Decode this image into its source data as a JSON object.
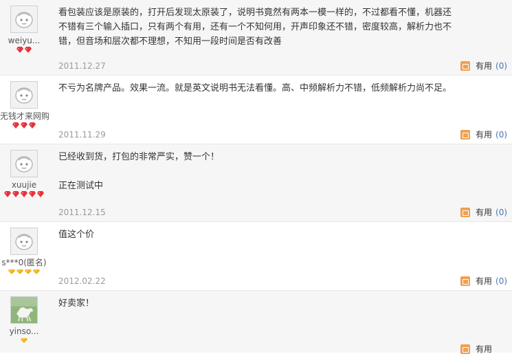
{
  "reviews": [
    {
      "username": "weiyu...",
      "level_icon": "red-diamond",
      "level_count": 2,
      "avatar": "default-face",
      "content": [
        "看包装应该是原装的，打开后发现太原装了，说明书竟然有两本一模一样的，不过都看不懂，机器还不错有三个输入插口，只有两个有用，还有一个不知何用，开声印象还不错，密度较高，解析力也不错，但音场和层次都不理想，不知用一段时间是否有改善"
      ],
      "date": "2011.12.27",
      "useful_label": "有用",
      "useful_count": "(0)"
    },
    {
      "username": "无钱才来网购",
      "level_icon": "red-diamond",
      "level_count": 3,
      "avatar": "default-face",
      "content": [
        "不亏为名牌产品。效果一流。就是英文说明书无法看懂。高、中频解析力不错，低频解析力尚不足。"
      ],
      "date": "2011.11.29",
      "useful_label": "有用",
      "useful_count": "(0)"
    },
    {
      "username": "xuujie",
      "level_icon": "red-diamond",
      "level_count": 5,
      "avatar": "default-face",
      "content": [
        "已经收到货，打包的非常严实，赞一个！",
        "正在测试中"
      ],
      "date": "2011.12.15",
      "useful_label": "有用",
      "useful_count": "(0)"
    },
    {
      "username": "s***0(匿名)",
      "level_icon": "yellow-heart",
      "level_count": 4,
      "avatar": "default-face",
      "content": [
        "值这个价"
      ],
      "date": "2012.02.22",
      "useful_label": "有用",
      "useful_count": "(0)"
    },
    {
      "username": "yinso...",
      "level_icon": "yellow-heart",
      "level_count": 1,
      "avatar": "photo-horse",
      "content": [
        "好卖家！"
      ],
      "date": "",
      "useful_label": "有用",
      "useful_count": ""
    }
  ],
  "colors": {
    "red_diamond": "#e8323c",
    "yellow_heart": "#f2b51c",
    "useful_count": "#4a73b5",
    "alt_row_bg": "#f6f6f6"
  }
}
